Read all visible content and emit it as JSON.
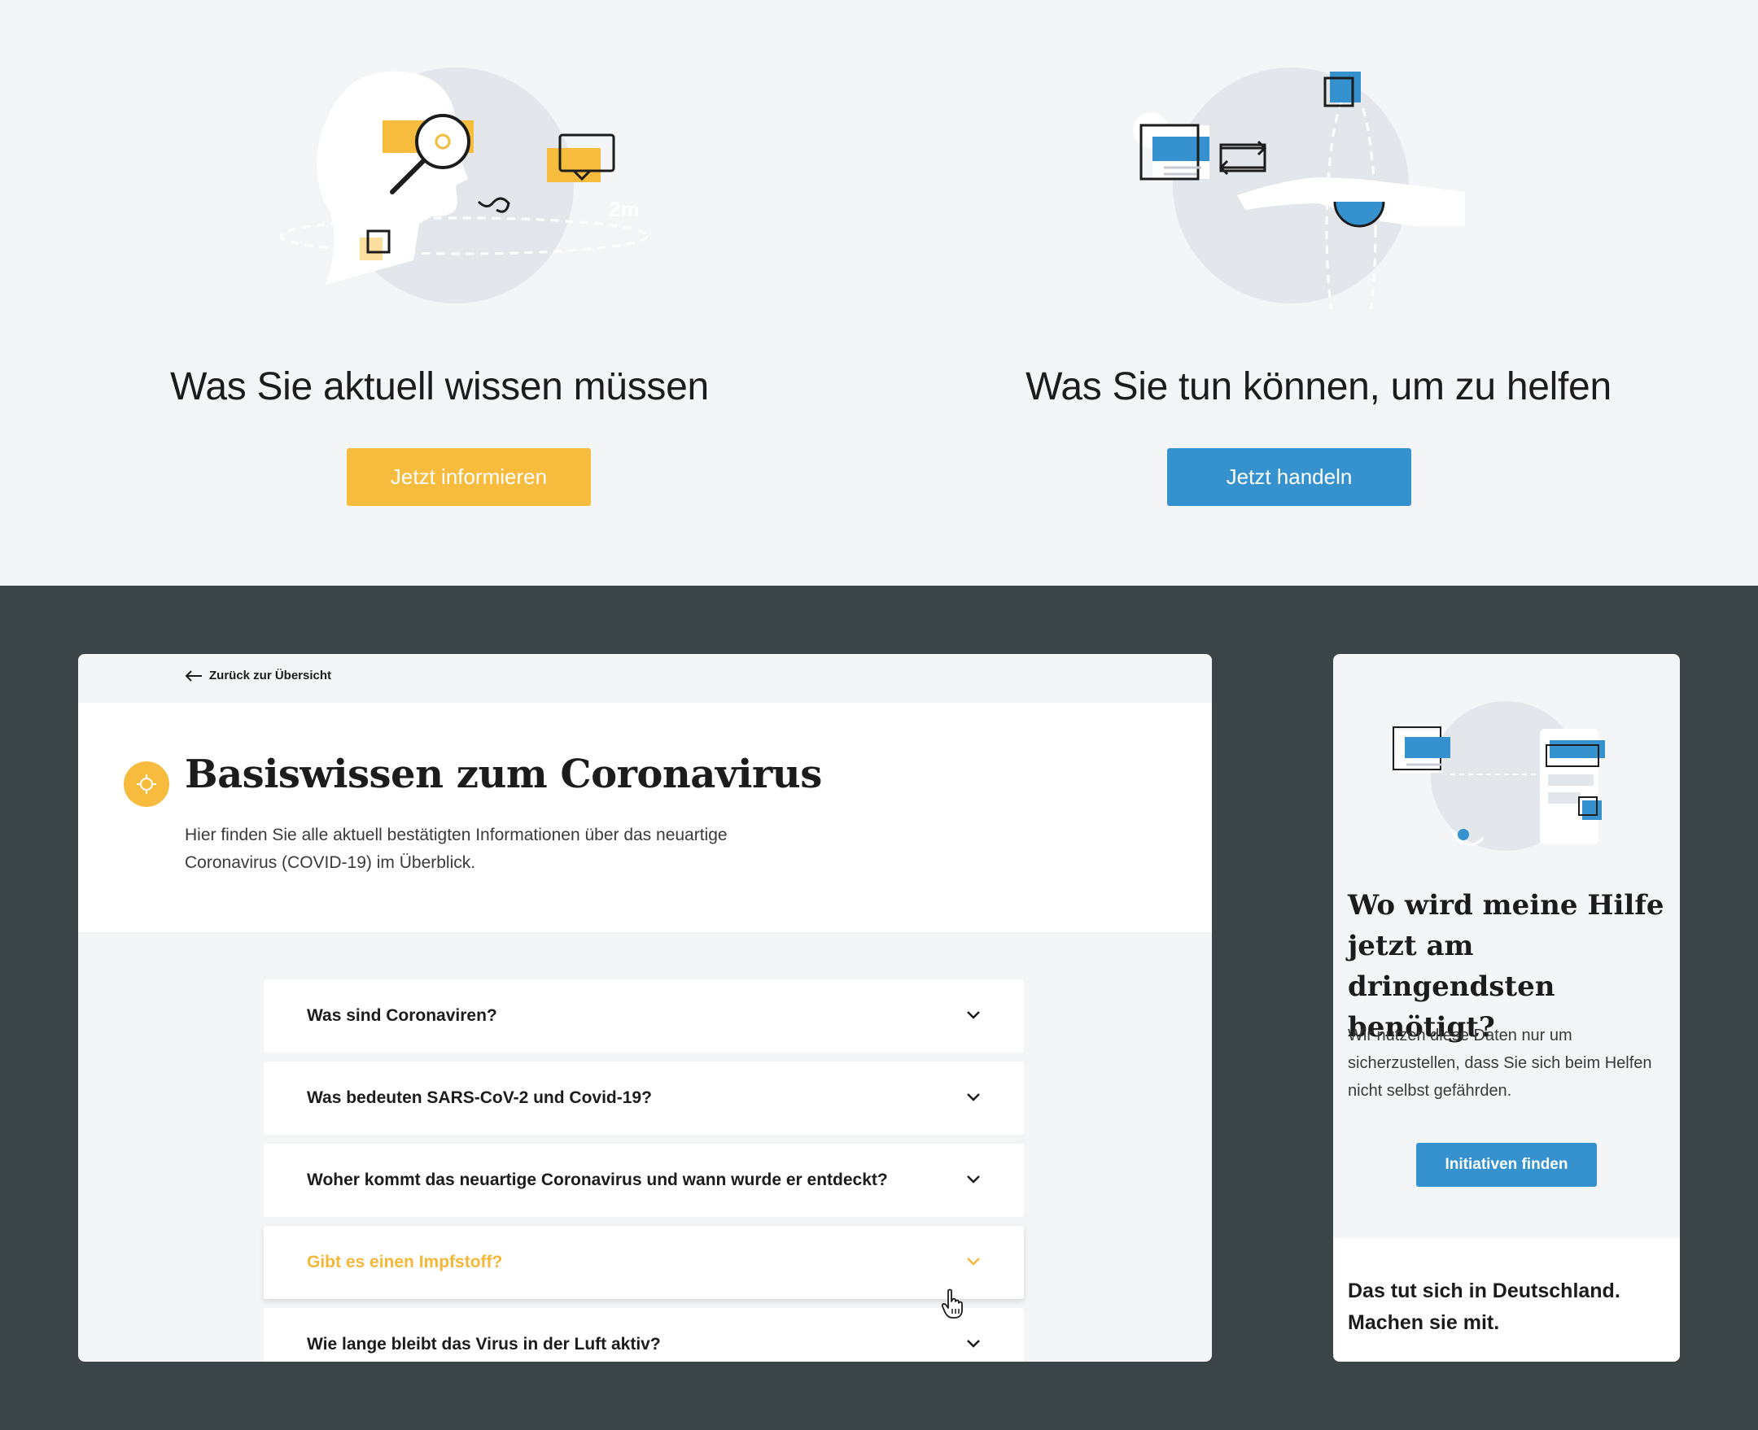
{
  "hero": {
    "left": {
      "title": "Was Sie aktuell wissen müssen",
      "button": "Jetzt informieren",
      "illustration_label": "2m"
    },
    "right": {
      "title": "Was Sie tun können, um zu helfen",
      "button": "Jetzt handeln"
    }
  },
  "main_card": {
    "back_link": "Zurück zur Übersicht",
    "title": "Basiswissen zum Coronavirus",
    "description": "Hier finden Sie alle aktuell bestätigten Informationen über das neuartige Coronavirus (COVID-19) im Überblick.",
    "faq": [
      {
        "question": "Was sind Coronaviren?",
        "active": false
      },
      {
        "question": "Was bedeuten SARS-CoV-2 und Covid-19?",
        "active": false
      },
      {
        "question": "Woher kommt das neuartige Coronavirus und wann wurde er entdeckt?",
        "active": false
      },
      {
        "question": "Gibt es einen Impfstoff?",
        "active": true
      },
      {
        "question": "Wie lange bleibt das Virus in der Luft aktiv?",
        "active": false
      }
    ]
  },
  "side_card": {
    "title": "Wo wird meine Hilfe jetzt am dringendsten benötigt?",
    "description": "Wir nutzen diese Daten nur um sicherzustellen, dass Sie sich beim Helfen nicht selbst gefährden.",
    "button": "Initiativen finden",
    "footer_line1": "Das tut sich in Deutschland.",
    "footer_line2": "Machen sie mit."
  },
  "colors": {
    "yellow": "#f7bb3d",
    "blue": "#3592cf",
    "dark_bg": "#3b4446",
    "light_bg": "#f4f5f7"
  }
}
